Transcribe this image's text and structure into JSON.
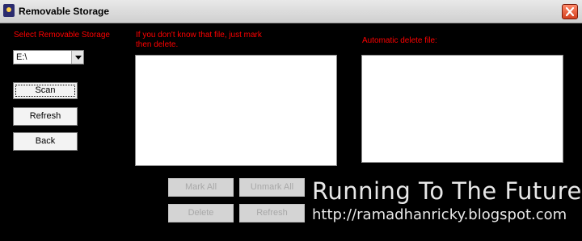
{
  "window": {
    "title": "Removable Storage",
    "close_icon": "close-icon"
  },
  "left_panel": {
    "label": "Select Removable Storage",
    "drive_select": {
      "value": "E:\\"
    },
    "scan_label": "Scan",
    "refresh_label": "Refresh",
    "back_label": "Back"
  },
  "middle_panel": {
    "label_line1": "If you don't know that file, just mark",
    "label_line2": "then delete."
  },
  "right_panel": {
    "label": "Automatic delete file:"
  },
  "actions": {
    "mark_all_label": "Mark All",
    "unmark_all_label": "Unmark All",
    "delete_label": "Delete",
    "refresh_label": "Refresh"
  },
  "watermark": {
    "title": "Running To The Future",
    "url": "http://ramadhanricky.blogspot.com"
  },
  "colors": {
    "background": "#000000",
    "label_red": "#ff0000",
    "close_button": "#d3401f"
  }
}
